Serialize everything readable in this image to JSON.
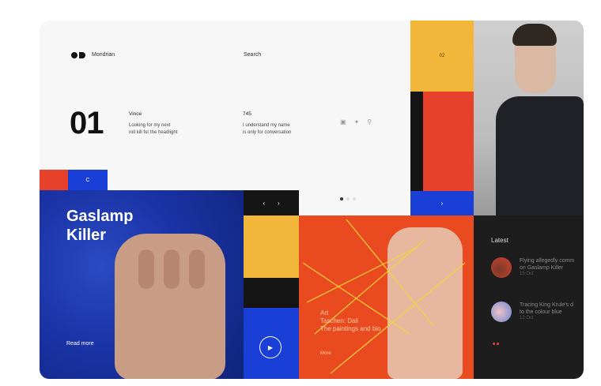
{
  "header": {
    "brand": "Mondrian",
    "search_label": "Search"
  },
  "hero": {
    "number": "01",
    "name": "Vince",
    "text": [
      "Looking for my next",
      "roll kill for the headlight"
    ],
    "count": "745",
    "quote": [
      "I understand my name",
      "is only for conversation"
    ]
  },
  "social_icons": [
    "calendar-icon",
    "twitter-icon",
    "location-icon"
  ],
  "pager": {
    "total": 3,
    "active_index": 0
  },
  "blocks": {
    "letter_c": "C",
    "number_02": "02",
    "next_arrow": "›"
  },
  "nav_arrows": {
    "prev": "‹",
    "next": "›"
  },
  "feature": {
    "title_line1": "Gaslamp",
    "title_line2": "Killer",
    "read_more": "Read more"
  },
  "art": {
    "category": "Art",
    "line1": "Taschen: Dali",
    "line2": "The paintings and bio",
    "more": "More"
  },
  "latest": {
    "title": "Latest",
    "items": [
      {
        "text1": "Flying allegedly comm",
        "text2": "on Gaslamp Killer",
        "date": "15 Oct"
      },
      {
        "text1": "Tracing King Krule's d",
        "text2": " to the colour blue",
        "date": "12 Oct"
      }
    ]
  },
  "colors": {
    "red": "#e8412b",
    "blue": "#1a3fd6",
    "yellow": "#f2b63a",
    "orange": "#ea4a1f",
    "dark": "#1d1d1d"
  }
}
